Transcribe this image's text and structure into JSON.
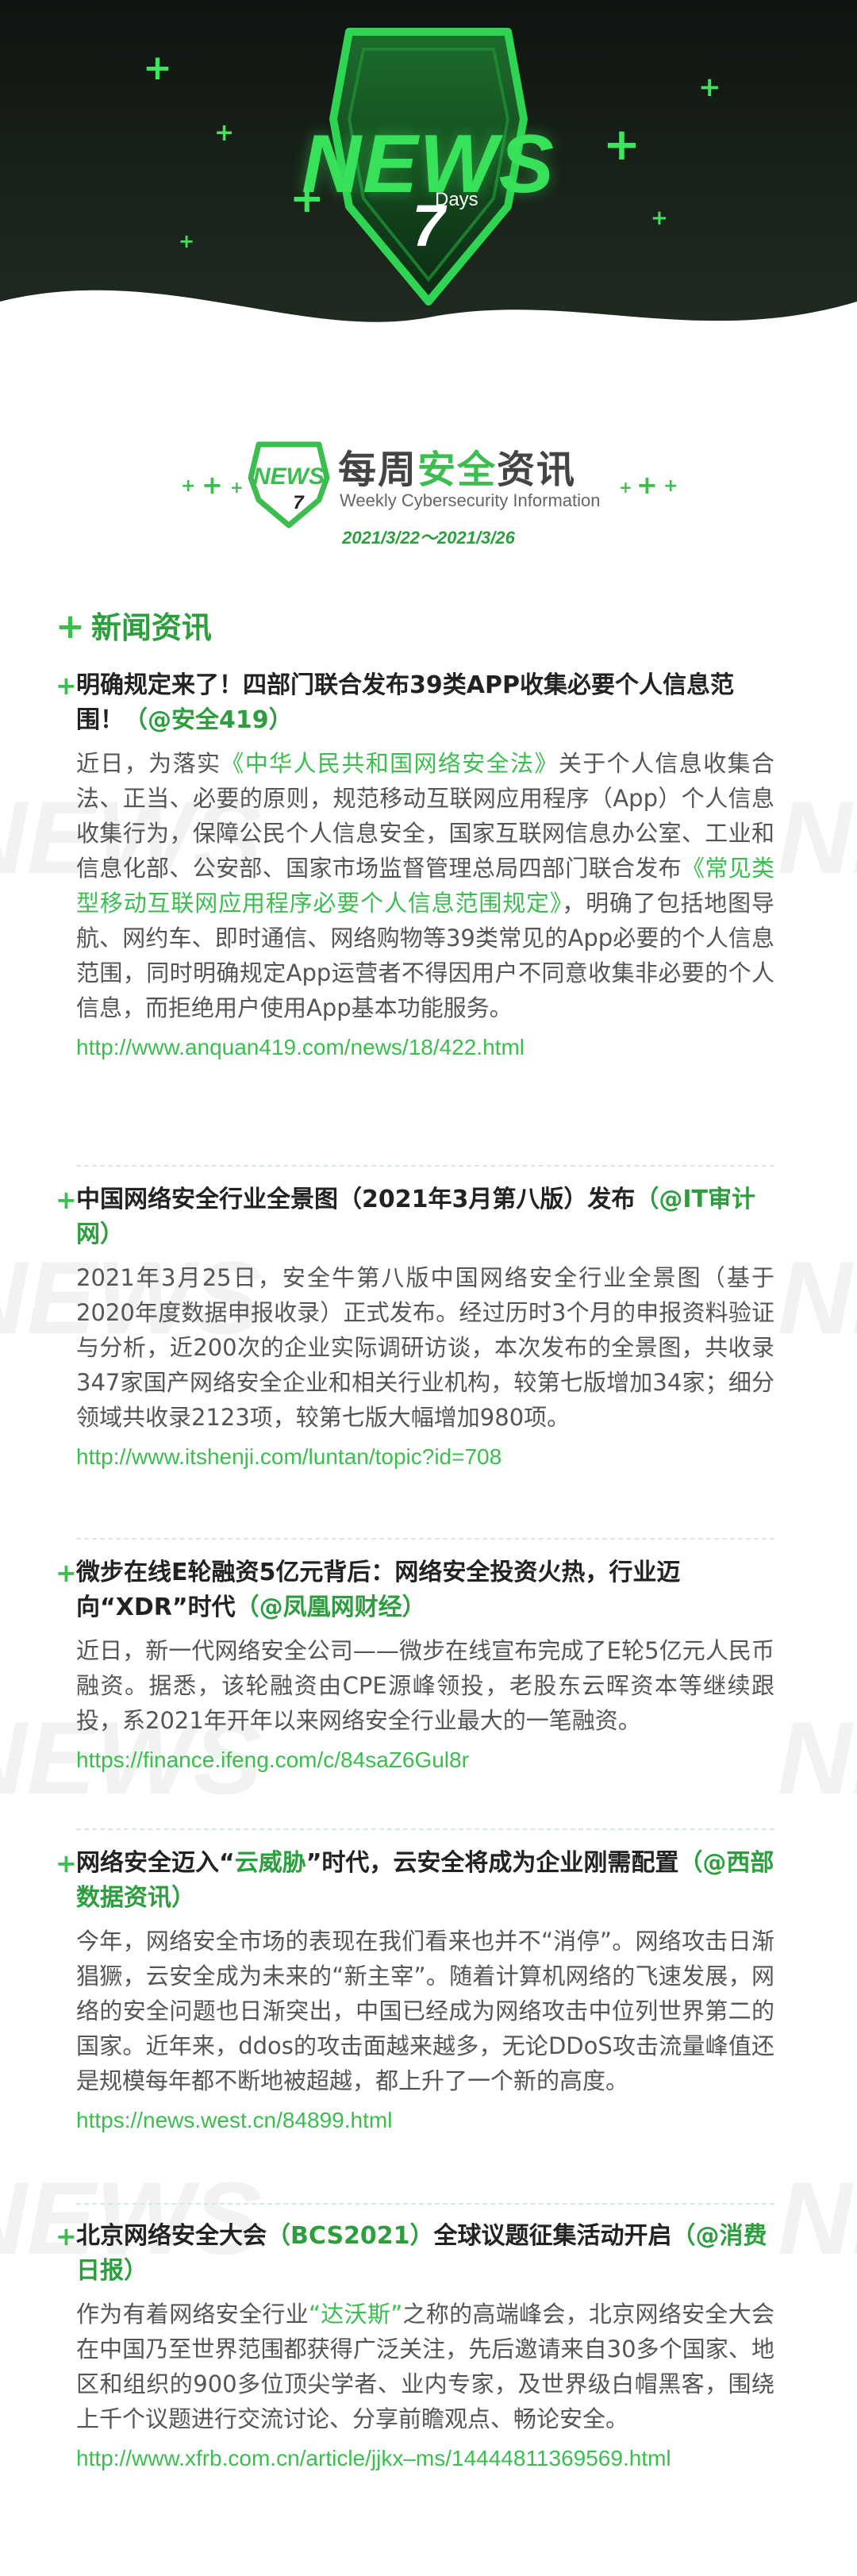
{
  "banner": {
    "news_word": "NEWS",
    "number": "7",
    "days_word": "Days"
  },
  "title_logo": {
    "mini_news": "NEWS",
    "mini_seven": "7",
    "title_part1": "每周",
    "title_highlight": "安全",
    "title_part2": "资讯",
    "subtitle_en": "Weekly Cybersecurity Information",
    "date_range": "2021/3/22～2021/3/26"
  },
  "section": {
    "heading": "新闻资讯"
  },
  "watermark_text": "NEWS",
  "articles": [
    {
      "title": "明确规定来了！四部门联合发布39类APP收集必要个人信息范围！",
      "source": "（@安全419）",
      "body_parts": [
        "近日，为落实",
        "《中华人民共和国网络安全法》",
        "关于个人信息收集合法、正当、必要的原则，规范移动互联网应用程序（App）个人信息收集行为，保障公民个人信息安全，国家互联网信息办公室、工业和信息化部、公安部、国家市场监督管理总局四部门联合发布",
        "《常见类型移动互联网应用程序必要个人信息范围规定》",
        "，明确了包括地图导航、网约车、即时通信、网络购物等39类常见的App必要的个人信息范围，同时明确规定App运营者不得因用户不同意收集非必要的个人信息，而拒绝用户使用App基本功能服务。"
      ],
      "link": "http://www.anquan419.com/news/18/422.html"
    },
    {
      "title": "中国网络安全行业全景图（2021年3月第八版）发布",
      "source": "（@IT审计网）",
      "body": "2021年3月25日，安全牛第八版中国网络安全行业全景图（基于2020年度数据申报收录）正式发布。经过历时3个月的申报资料验证与分析，近200次的企业实际调研访谈，本次发布的全景图，共收录347家国产网络安全企业和相关行业机构，较第七版增加34家；细分领域共收录2123项，较第七版大幅增加980项。",
      "link": "http://www.itshenji.com/luntan/topic?id=708"
    },
    {
      "title": "微步在线E轮融资5亿元背后：网络安全投资火热，行业迈向“XDR”时代",
      "source": "（@凤凰网财经）",
      "body": "近日，新一代网络安全公司——微步在线宣布完成了E轮5亿元人民币融资。据悉，该轮融资由CPE源峰领投，老股东云晖资本等继续跟投，系2021年开年以来网络安全行业最大的一笔融资。",
      "link": "https://finance.ifeng.com/c/84saZ6Gul8r"
    },
    {
      "title_part1": "网络安全迈入“",
      "title_highlight": "云威胁",
      "title_part2": "”时代，云安全将成为企业刚需配置",
      "source": "（@西部数据资讯）",
      "body": "今年，网络安全市场的表现在我们看来也并不“消停”。网络攻击日渐猖獗，云安全成为未来的“新主宰”。随着计算机网络的飞速发展，网络的安全问题也日渐突出，中国已经成为网络攻击中位列世界第二的国家。近年来，ddos的攻击面越来越多，无论DDoS攻击流量峰值还是规模每年都不断地被超越，都上升了一个新的高度。",
      "link": "https://news.west.cn/84899.html"
    },
    {
      "title_part1": "北京网络安全大会",
      "title_highlight": "（BCS2021）",
      "title_part2": "全球议题征集活动开启",
      "source": "（@消费日报）",
      "body_parts": [
        "作为有着网络安全行业",
        "“达沃斯”",
        "之称的高端峰会，北京网络安全大会在中国乃至世界范围都获得广泛关注，先后邀请来自30多个国家、地区和组织的900多位顶尖学者、业内专家，及世界级白帽黑客，围绕上千个议题进行交流讨论、分享前瞻观点、畅论安全。"
      ],
      "link": "http://www.xfrb.com.cn/article/jjkx–ms/14444811369569.html"
    }
  ]
}
